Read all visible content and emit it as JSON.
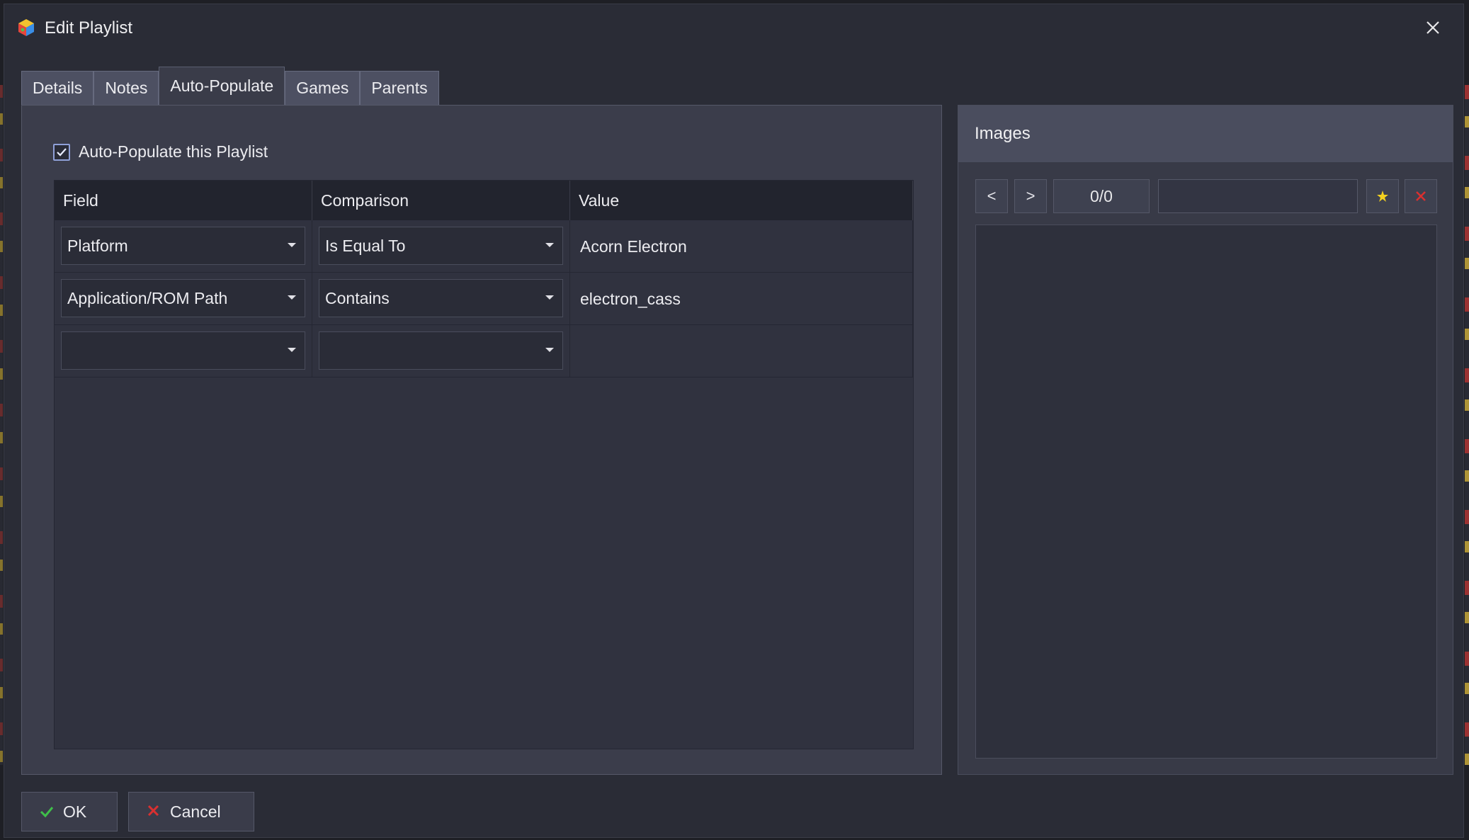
{
  "window": {
    "title": "Edit Playlist"
  },
  "tabs": [
    {
      "label": "Details"
    },
    {
      "label": "Notes"
    },
    {
      "label": "Auto-Populate",
      "active": true
    },
    {
      "label": "Games"
    },
    {
      "label": "Parents"
    }
  ],
  "auto_populate": {
    "checkbox_label": "Auto-Populate this Playlist",
    "checked": true,
    "columns": [
      "Field",
      "Comparison",
      "Value"
    ],
    "rows": [
      {
        "field": "Platform",
        "comparison": "Is Equal To",
        "value": "Acorn Electron"
      },
      {
        "field": "Application/ROM Path",
        "comparison": "Contains",
        "value": "electron_cass"
      },
      {
        "field": "",
        "comparison": "",
        "value": ""
      }
    ]
  },
  "images": {
    "title": "Images",
    "prev_label": "<",
    "next_label": ">",
    "counter": "0/0",
    "add_icon": "star-add-icon",
    "remove_icon": "red-x-icon"
  },
  "footer": {
    "ok_label": "OK",
    "cancel_label": "Cancel"
  },
  "colors": {
    "background": "#2a2c36",
    "accent_check": "#8fa0d8",
    "ok_green": "#3fbf4a",
    "cancel_red": "#d93030"
  }
}
